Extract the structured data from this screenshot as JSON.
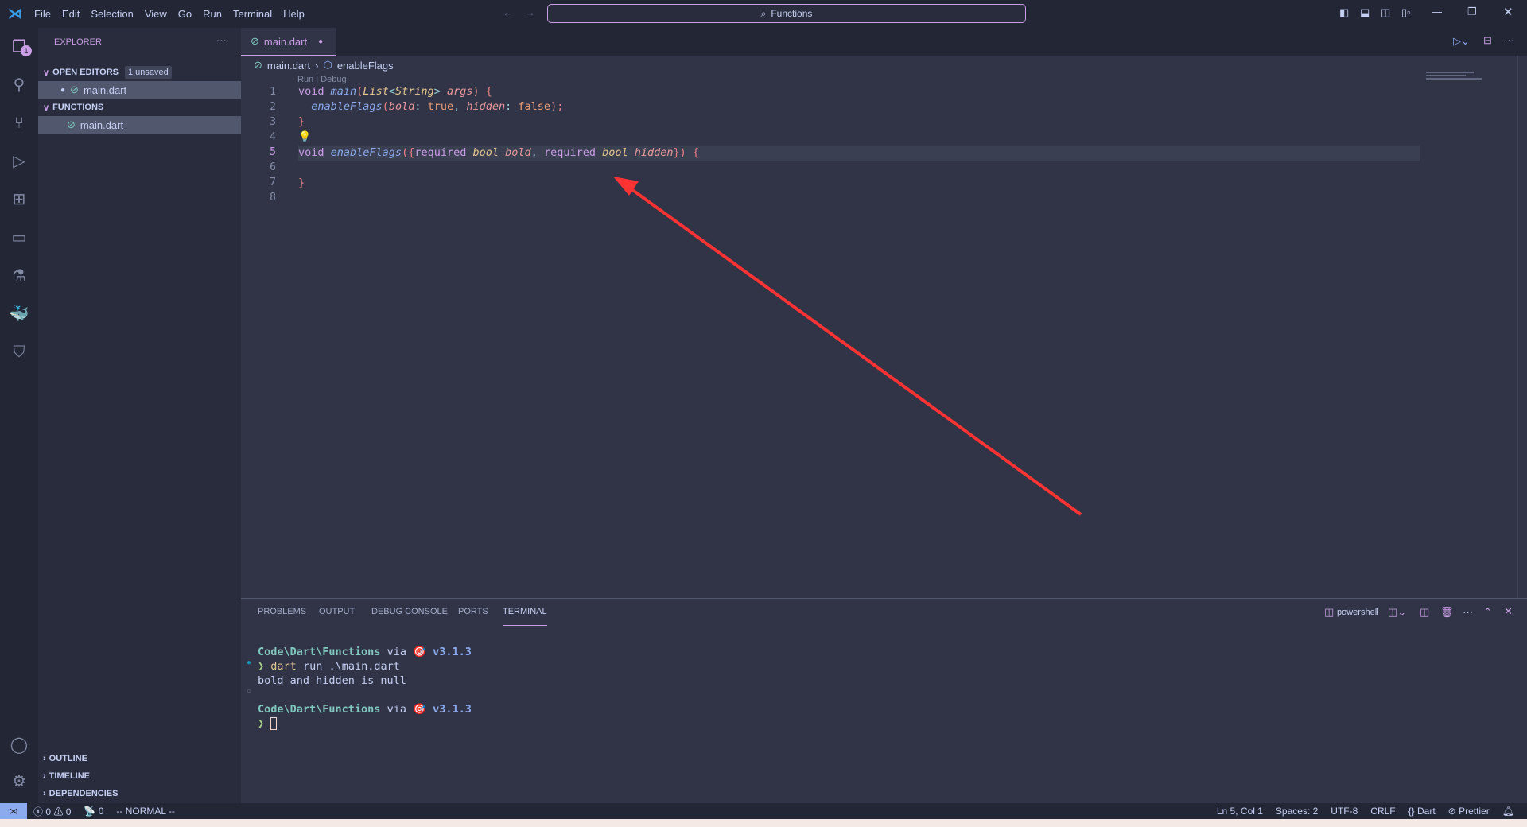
{
  "menu": [
    "File",
    "Edit",
    "Selection",
    "View",
    "Go",
    "Run",
    "Terminal",
    "Help"
  ],
  "command_center": "Functions",
  "sidebar": {
    "title": "EXPLORER",
    "open_editors": "OPEN EDITORS",
    "unsaved_badge": "1 unsaved",
    "open_file": "main.dart",
    "folder": "FUNCTIONS",
    "folder_file": "main.dart",
    "outline": "OUTLINE",
    "timeline": "TIMELINE",
    "dependencies": "DEPENDENCIES",
    "explorer_badge": "1"
  },
  "tab": {
    "label": "main.dart",
    "dirty": true
  },
  "breadcrumb": {
    "file": "main.dart",
    "symbol": "enableFlags"
  },
  "codelens": "Run | Debug",
  "lines": [
    "1",
    "2",
    "3",
    "4",
    "5",
    "6",
    "7",
    "8"
  ],
  "code": {
    "l1": [
      "void",
      " ",
      "main",
      "(",
      "List",
      "<",
      "String",
      "> ",
      "args",
      ") {"
    ],
    "l2": [
      "  ",
      "enableFlags",
      "(",
      "bold",
      ": ",
      "true",
      ", ",
      "hidden",
      ": ",
      "false",
      ");"
    ],
    "l3": "}",
    "l5": [
      "void",
      " ",
      "enableFlags",
      "({",
      "required",
      " ",
      "bool",
      " ",
      "bold",
      ", ",
      "required",
      " ",
      "bool",
      " ",
      "hidden",
      "}) {"
    ],
    "l7": "}"
  },
  "panel": {
    "tabs": [
      "PROBLEMS",
      "OUTPUT",
      "DEBUG CONSOLE",
      "PORTS",
      "TERMINAL"
    ],
    "active": "TERMINAL",
    "shell": "powershell"
  },
  "terminal": {
    "path": "Code\\Dart\\Functions",
    "via": "via",
    "version": "v3.1.3",
    "prompt": "❯",
    "command": "dart",
    "args": "run .\\main.dart",
    "output": "bold and hidden is null"
  },
  "status": {
    "errors": "0",
    "warnings": "0",
    "ports": "0",
    "mode": "-- NORMAL --",
    "position": "Ln 5, Col 1",
    "spaces": "Spaces: 2",
    "encoding": "UTF-8",
    "eol": "CRLF",
    "language": "Dart",
    "formatter": "Prettier"
  },
  "colors": {
    "accent": "#ca9ee6",
    "editor_bg": "#303446",
    "annotation_arrow": "#ff3333"
  }
}
